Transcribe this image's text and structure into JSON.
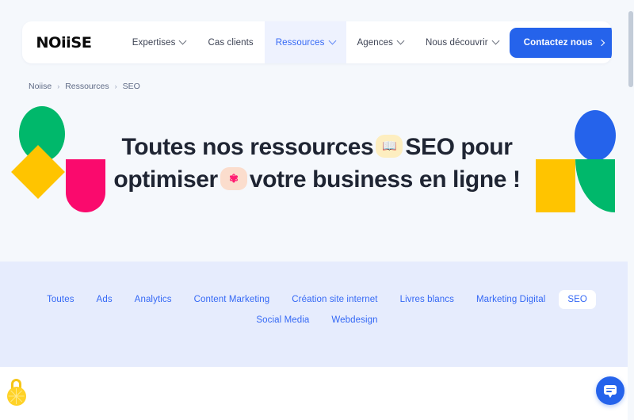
{
  "site": {
    "logo_text": "NOiiSE",
    "background_color": "#f5f8fc",
    "accent_color": "#2563eb",
    "link_color": "#3468f5"
  },
  "header": {
    "nav": [
      {
        "label": "Expertises",
        "has_dropdown": true,
        "active": false
      },
      {
        "label": "Cas clients",
        "has_dropdown": false,
        "active": false
      },
      {
        "label": "Ressources",
        "has_dropdown": true,
        "active": true
      },
      {
        "label": "Agences",
        "has_dropdown": true,
        "active": false
      },
      {
        "label": "Nous découvrir",
        "has_dropdown": true,
        "active": false
      }
    ],
    "cta_label": "Contactez nous"
  },
  "breadcrumb": {
    "items": [
      "Noiise",
      "Ressources",
      "SEO"
    ],
    "separator": "›"
  },
  "hero": {
    "title_part1": "Toutes nos ressources",
    "badge1_icon": "open-book-emoji",
    "badge1_glyph": "📖",
    "title_part2": "SEO pour optimiser",
    "badge2_icon": "gear-emoji",
    "badge2_glyph": "✾",
    "title_part3": "votre business en ligne !",
    "decorations": [
      {
        "name": "green-ellipse",
        "color": "#00b86b"
      },
      {
        "name": "yellow-diamond",
        "color": "#ffc400"
      },
      {
        "name": "pink-half-pill",
        "color": "#fa0a6d"
      },
      {
        "name": "blue-ellipse",
        "color": "#2563eb"
      },
      {
        "name": "yellow-square",
        "color": "#ffc400"
      },
      {
        "name": "green-quarter-disc",
        "color": "#00b86b"
      }
    ]
  },
  "filters": {
    "band_color": "#e6ecfd",
    "items": [
      {
        "label": "Toutes",
        "active": false
      },
      {
        "label": "Ads",
        "active": false
      },
      {
        "label": "Analytics",
        "active": false
      },
      {
        "label": "Content Marketing",
        "active": false
      },
      {
        "label": "Création site internet",
        "active": false
      },
      {
        "label": "Livres blancs",
        "active": false
      },
      {
        "label": "Marketing Digital",
        "active": false
      },
      {
        "label": "SEO",
        "active": true
      },
      {
        "label": "Social Media",
        "active": false
      },
      {
        "label": "Webdesign",
        "active": false
      }
    ]
  },
  "widgets": {
    "privacy_lock_icon": "padlock-icon",
    "chat_icon": "chat-bubble-icon"
  }
}
